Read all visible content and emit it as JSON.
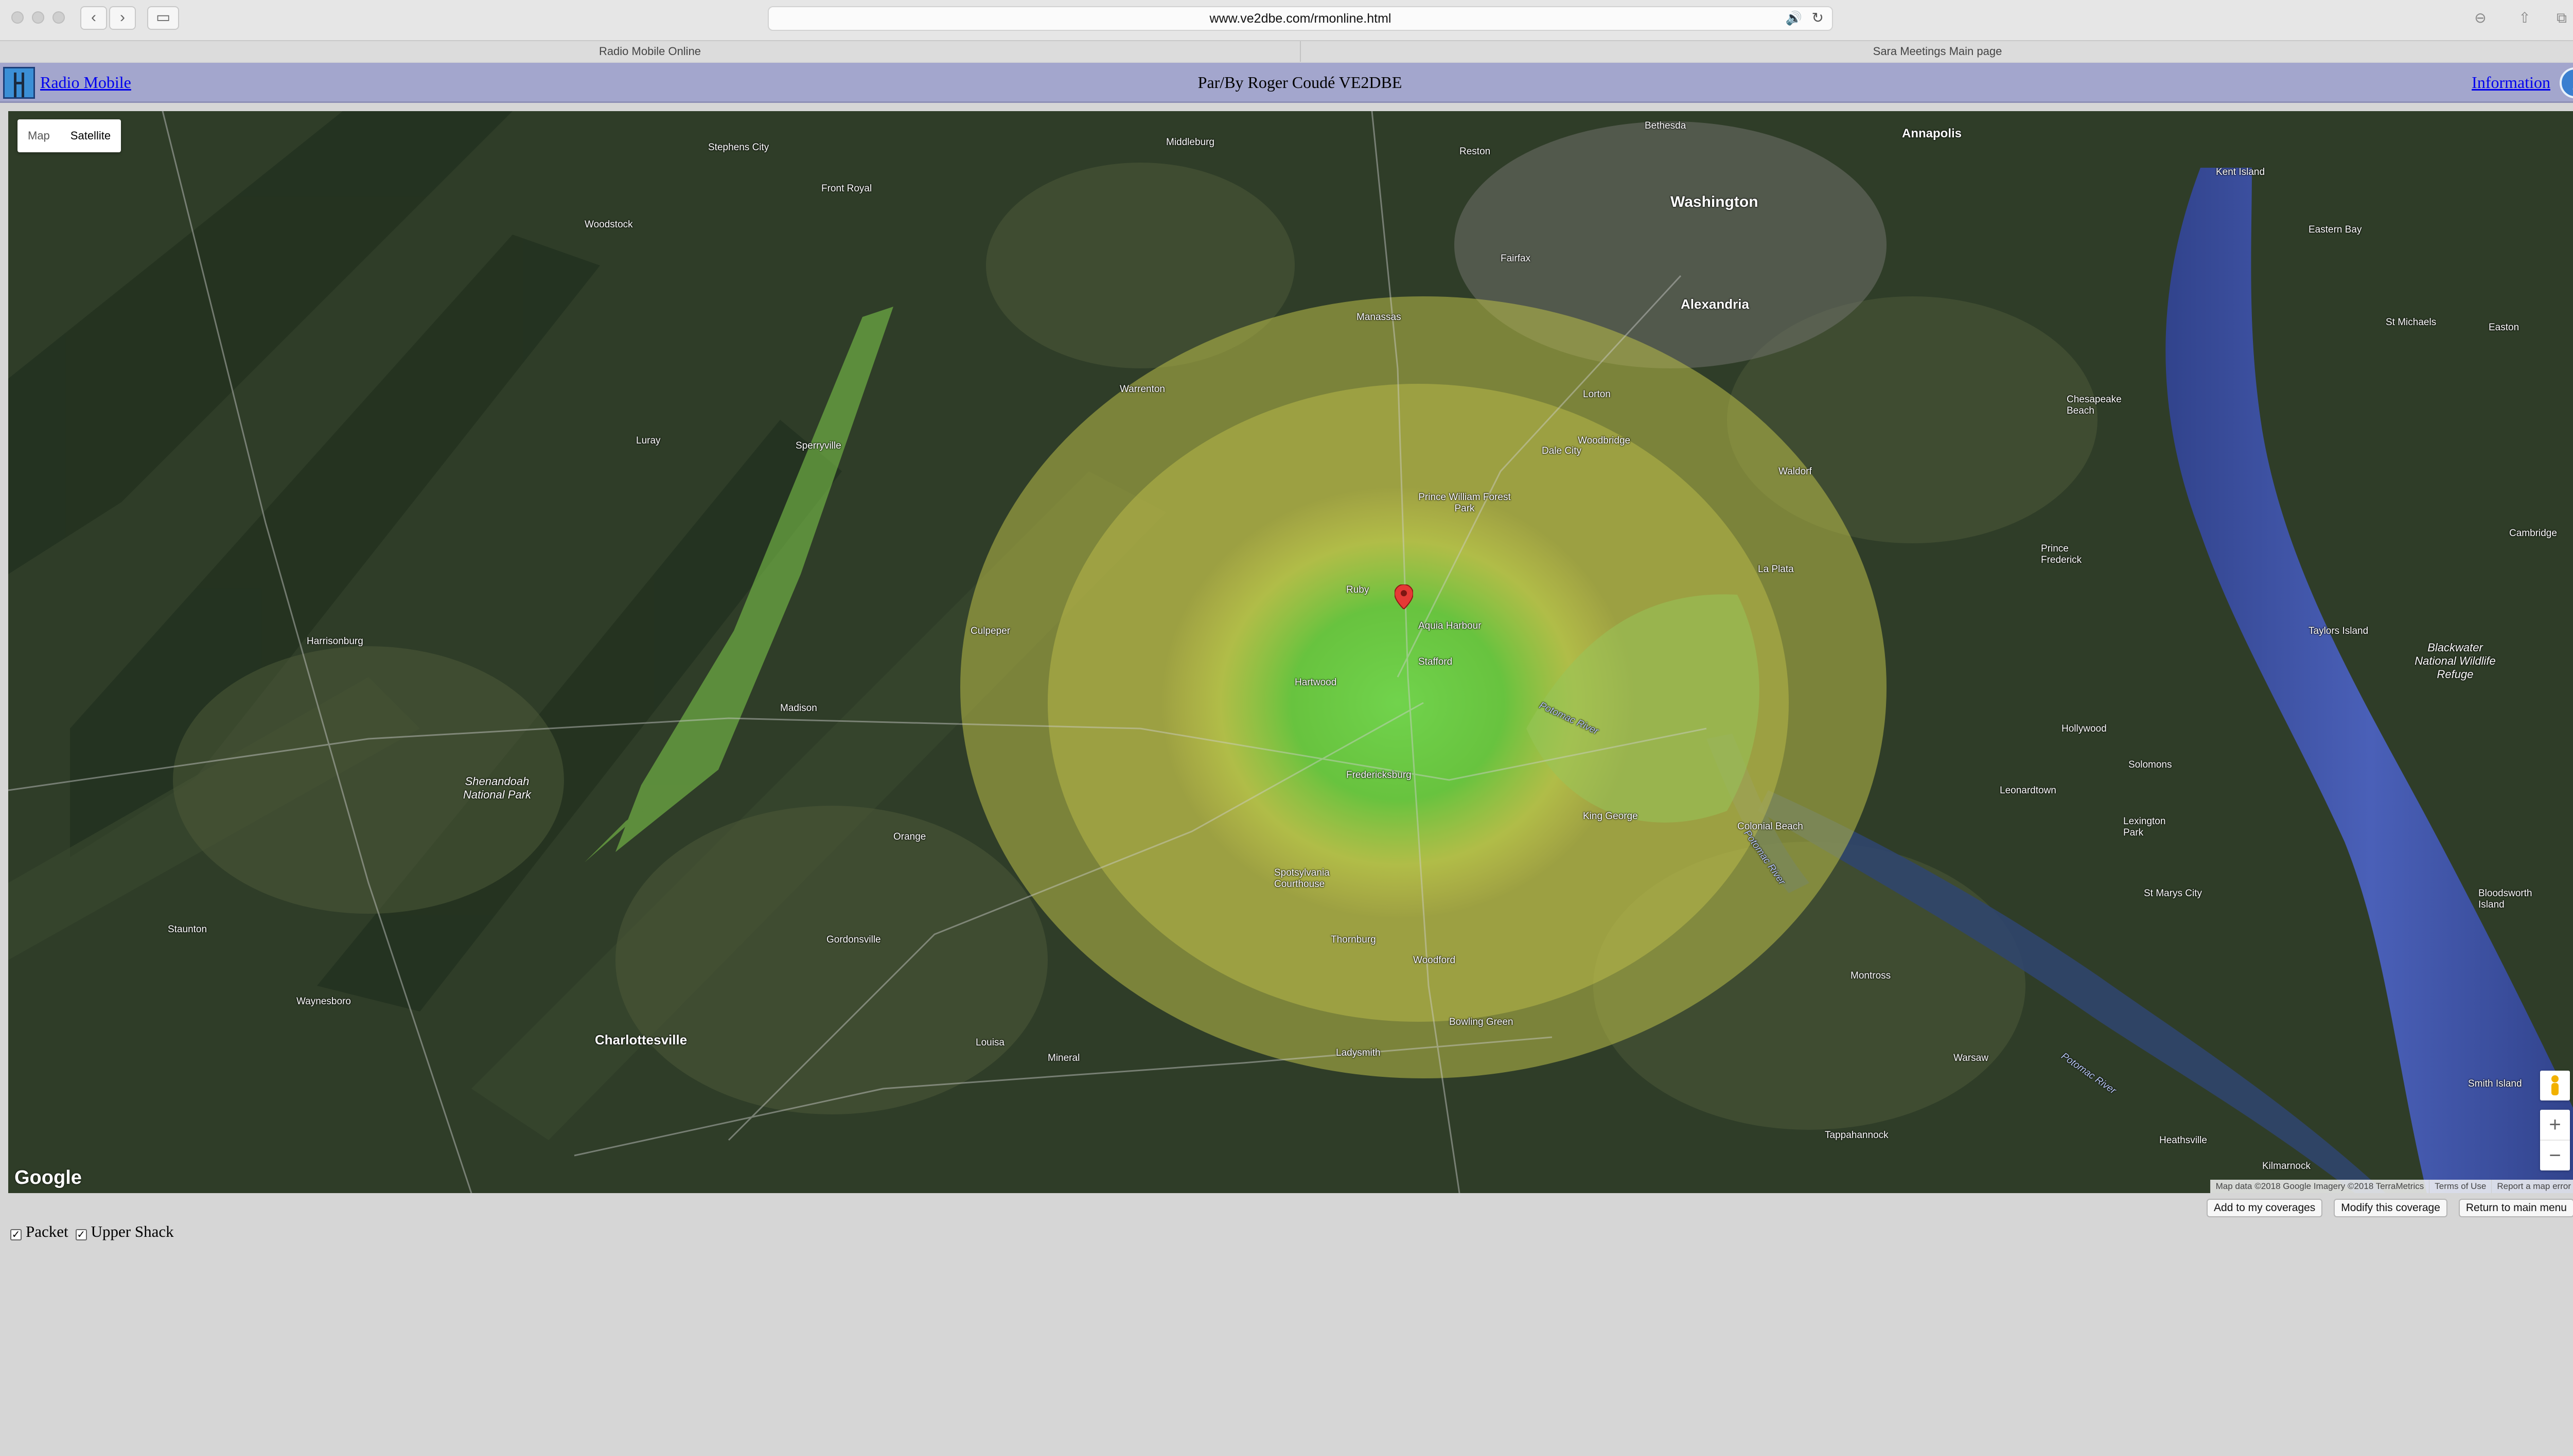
{
  "browser": {
    "url": "www.ve2dbe.com/rmonline.html",
    "tabs": [
      {
        "title": "Radio Mobile Online"
      },
      {
        "title": "Sara Meetings Main page"
      }
    ]
  },
  "header": {
    "brand_link": "Radio Mobile",
    "author": "Par/By Roger Coudé VE2DBE",
    "info_link": "Information",
    "info_icon": "i"
  },
  "map": {
    "type_buttons": [
      "Map",
      "Satellite"
    ],
    "active_type": "Satellite",
    "google": "Google",
    "attribution": [
      "Map data ©2018 Google Imagery ©2018 TerraMetrics",
      "Terms of Use",
      "Report a map error"
    ],
    "zoom_in": "+",
    "zoom_out": "−",
    "places": {
      "washington": "Washington",
      "alexandria": "Alexandria",
      "reston": "Reston",
      "bethesda": "Bethesda",
      "annapolis": "Annapolis",
      "kent_island": "Kent Island",
      "eastern_bay": "Eastern Bay",
      "fairfax": "Fairfax",
      "manassas": "Manassas",
      "warrenton": "Warrenton",
      "culpeper": "Culpeper",
      "fredericksburg": "Fredericksburg",
      "stafford": "Stafford",
      "aquia_harbour": "Aquia Harbour",
      "ruby": "Ruby",
      "hartwood": "Hartwood",
      "potomac_river_1": "Potomac River",
      "potomac_river_2": "Potomac River",
      "potomac_river_3": "Potomac River",
      "prince_william": "Prince William Forest Park",
      "dale_city": "Dale City",
      "woodbridge": "Woodbridge",
      "lorton": "Lorton",
      "waldorf": "Waldorf",
      "la_plata": "La Plata",
      "king_george": "King George",
      "colonial_beach": "Colonial Beach",
      "montross": "Montross",
      "warsaw": "Warsaw",
      "tappahannock": "Tappahannock",
      "bowling_green": "Bowling Green",
      "ladysmith": "Ladysmith",
      "spotsylvania": "Spotsylvania Courthouse",
      "orange": "Orange",
      "gordonsville": "Gordonsville",
      "charlottesville": "Charlottesville",
      "louisa": "Louisa",
      "mineral": "Mineral",
      "shenandoah": "Shenandoah National Park",
      "harrisonburg": "Harrisonburg",
      "staunton": "Staunton",
      "waynesboro": "Waynesboro",
      "front_royal": "Front Royal",
      "luray": "Luray",
      "woodstock": "Woodstock",
      "winchester": "Stephens City",
      "leesburg": "Middleburg",
      "madison": "Madison",
      "sperryville": "Sperryville",
      "lexington_park": "Lexington Park",
      "solomons": "Solomons",
      "prince_frederick": "Prince Frederick",
      "st_michaels": "St Michaels",
      "blackwater": "Blackwater National Wildlife Refuge",
      "bloodsworth": "Bloodsworth Island",
      "taylors_island": "Taylors Island",
      "chesapeake_beach": "Chesapeake Beach",
      "smith_island": "Smith Island",
      "heathsville": "Heathsville",
      "kilmarnock": "Kilmarnock",
      "cambridge": "Cambridge",
      "easton": "Easton",
      "woodford": "Woodford",
      "thornburg": "Thornburg",
      "hollywood": "Hollywood",
      "leonardtown": "Leonardtown",
      "st_marys": "St Marys City"
    }
  },
  "actions": {
    "add": "Add to my coverages",
    "modify": "Modify this coverage",
    "return": "Return to main menu"
  },
  "layers": [
    {
      "label": "Packet",
      "checked": true
    },
    {
      "label": "Upper Shack",
      "checked": true
    }
  ]
}
